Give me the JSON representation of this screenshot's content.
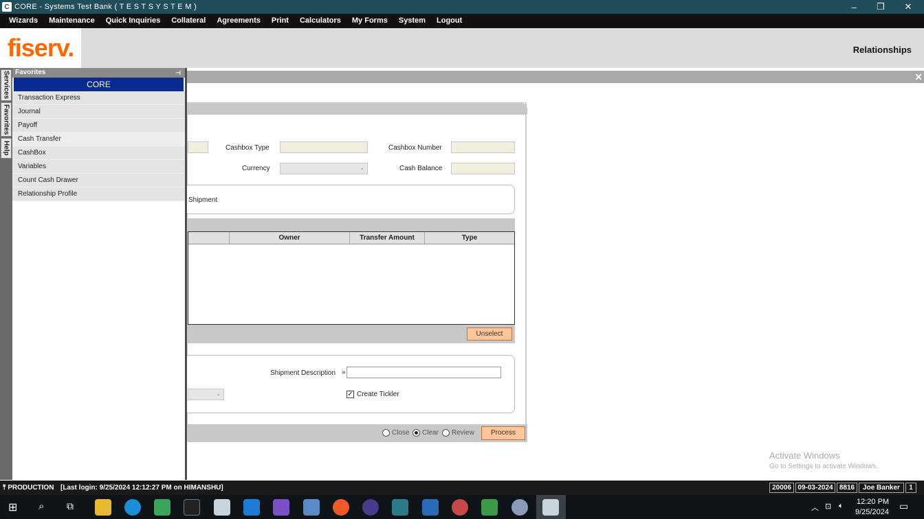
{
  "window": {
    "title": "CORE - Systems Test Bank ( T E S T   S Y S T E M )",
    "minimize": "–",
    "maximize": "❐",
    "close": "✕"
  },
  "menu": {
    "items": [
      "Wizards",
      "Maintenance",
      "Quick Inquiries",
      "Collateral",
      "Agreements",
      "Print",
      "Calculators",
      "My Forms",
      "System",
      "Logout"
    ]
  },
  "header": {
    "logo": "fiserv.",
    "title": "Relationships"
  },
  "side_tabs": [
    "Services",
    "Favorites",
    "Help"
  ],
  "favorites": {
    "title": "Favorites",
    "group": "CORE",
    "items": [
      "Transaction Express",
      "Journal",
      "Payoff",
      "Cash Transfer",
      "CashBox",
      "Variables",
      "Count Cash Drawer",
      "Relationship Profile"
    ]
  },
  "form": {
    "cashbox_type_label": "Cashbox Type",
    "cashbox_number_label": "Cashbox Number",
    "currency_label": "Currency",
    "cash_balance_label": "Cash Balance",
    "shipment_label": "Shipment",
    "grid_columns": [
      "Owner",
      "Transfer Amount",
      "Type"
    ],
    "unselect_label": "Unselect",
    "shipment_description_label": "Shipment Description",
    "shipment_description_marker": "»",
    "create_tickler_label": "Create Tickler",
    "create_tickler_checked": true,
    "radio_close": "Close",
    "radio_clear": "Clear",
    "radio_review": "Review",
    "process_label": "Process"
  },
  "watermark": {
    "line1": "Activate Windows",
    "line2": "Go to Settings to activate Windows."
  },
  "status": {
    "environment": "PRODUCTION",
    "last_login": "[Last login: 9/25/2024 12:12:27 PM on HIMANSHU]",
    "branch": "20006",
    "date": "09-03-2024",
    "teller": "8816",
    "user": "Joe Banker",
    "session": "1"
  },
  "taskbar": {
    "time": "12:20 PM",
    "date": "9/25/2024"
  },
  "colors": {
    "titlebar": "#1f4e5a",
    "accent_button": "#ffc69a",
    "core_header": "#0a2a8f",
    "logo": "#ff6600"
  }
}
